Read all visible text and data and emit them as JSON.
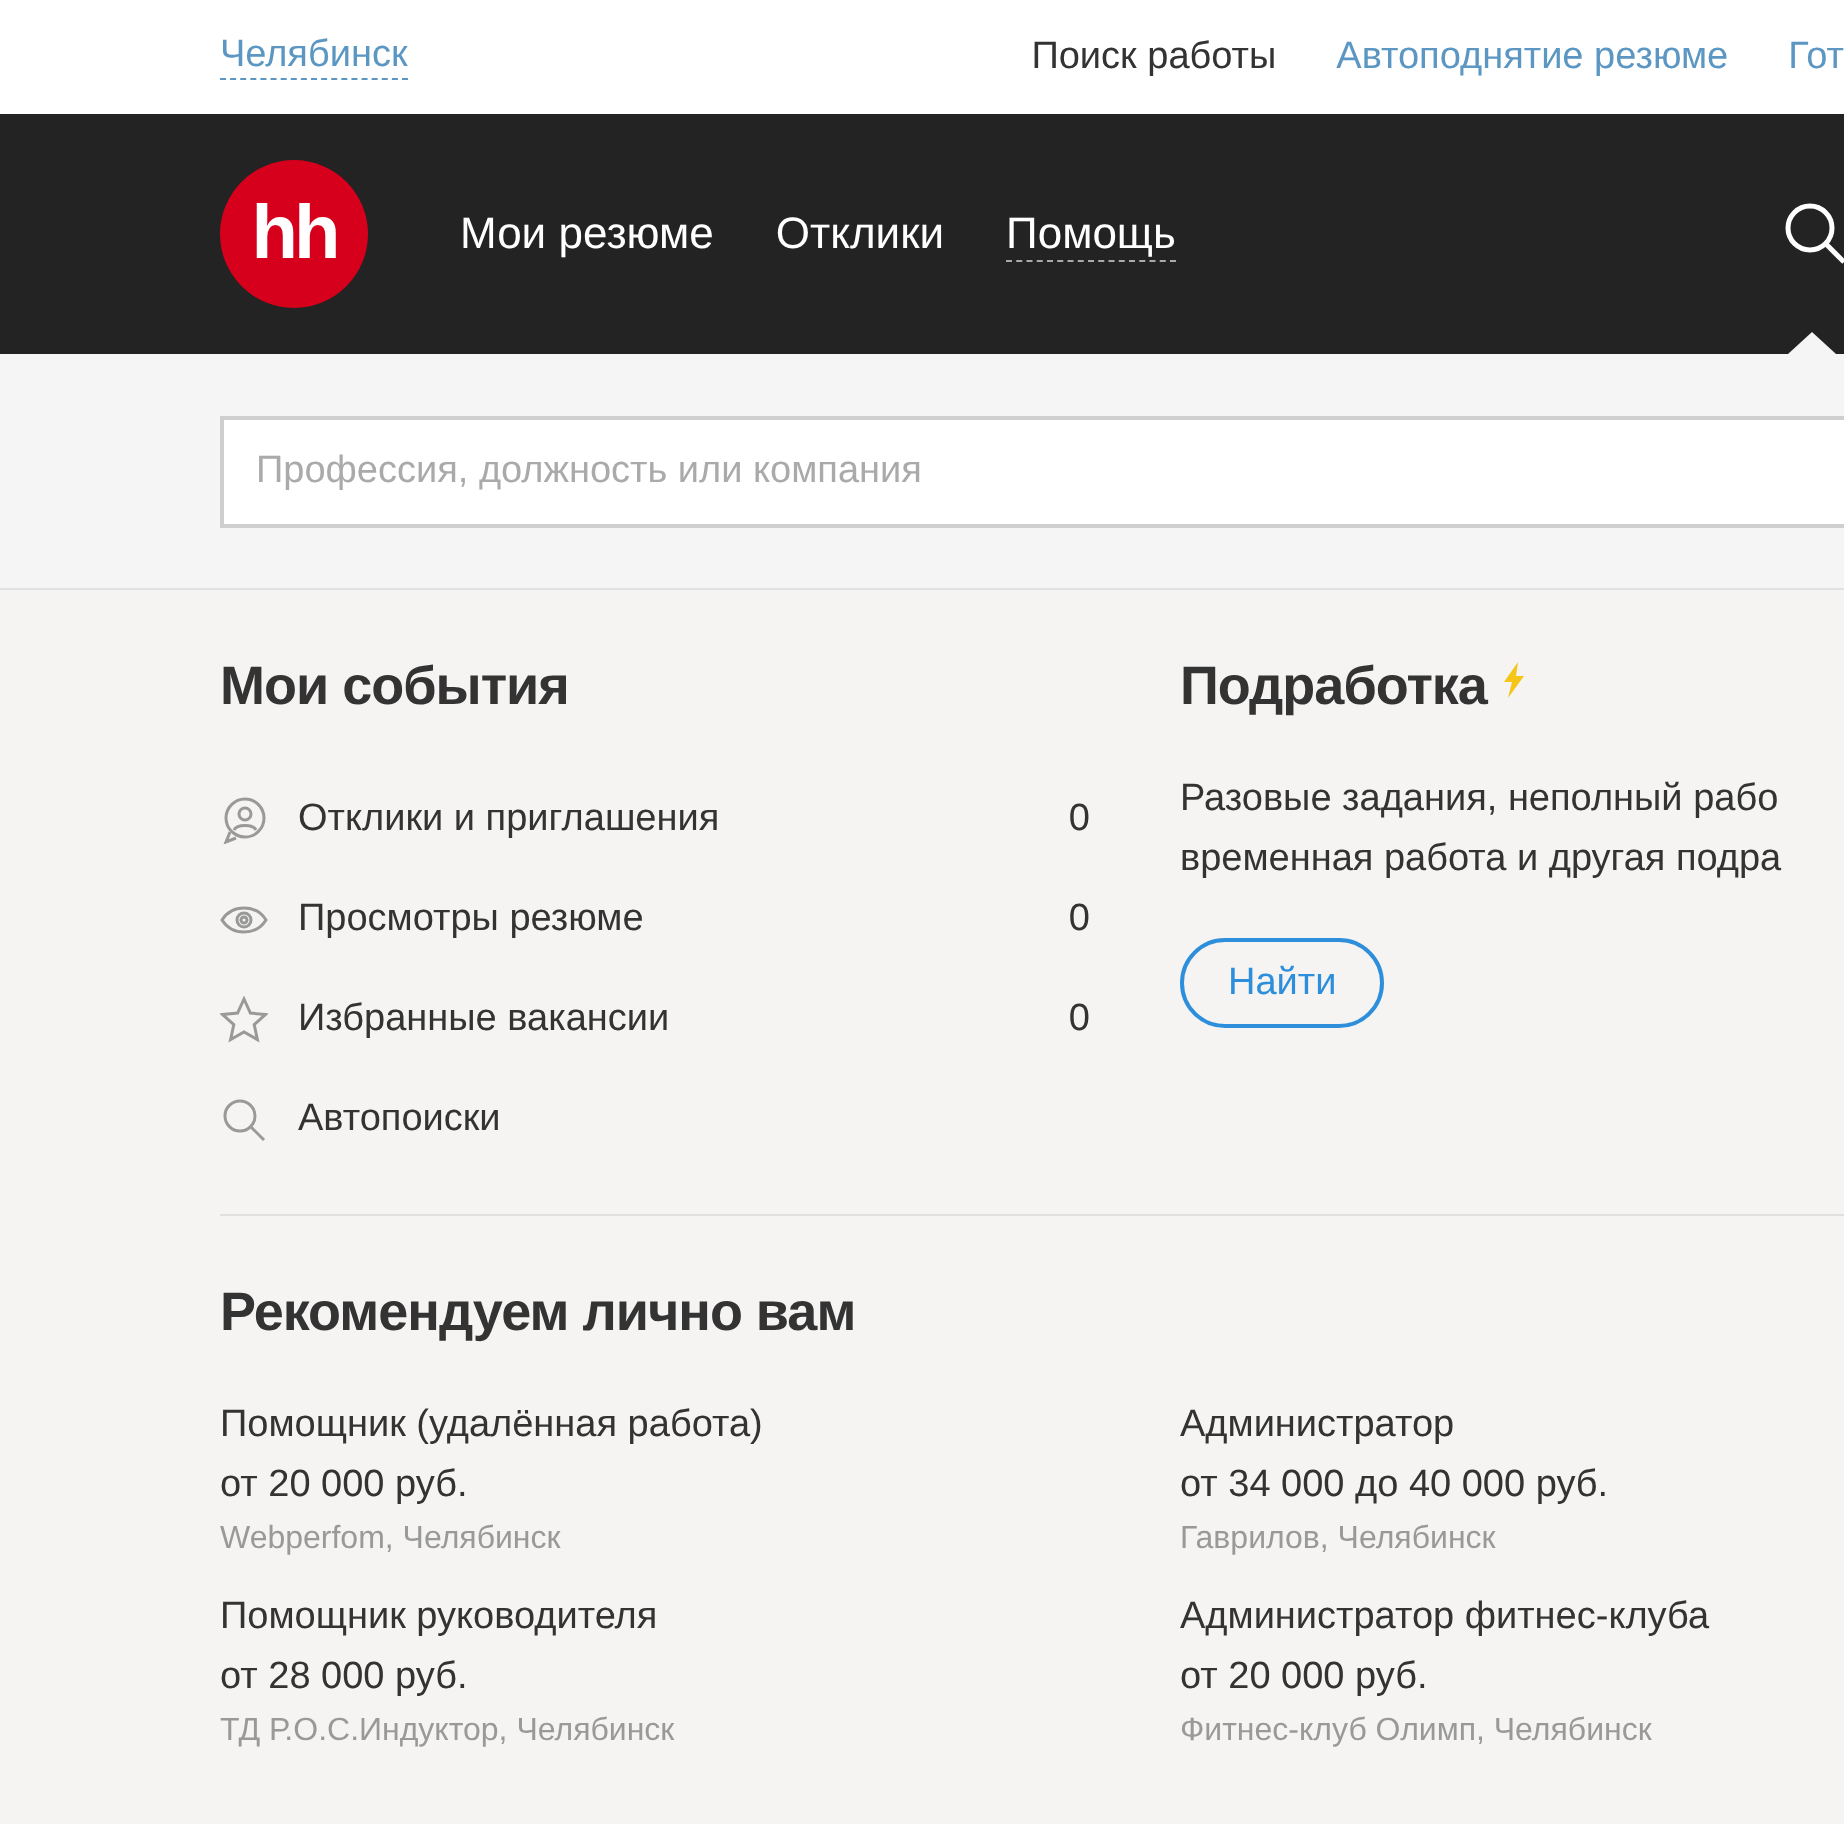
{
  "top_bar": {
    "city": "Челябинск",
    "links": [
      {
        "label": "Поиск работы",
        "selected": true
      },
      {
        "label": "Автоподнятие резюме",
        "selected": false
      },
      {
        "label": "Гот",
        "selected": false
      }
    ]
  },
  "header": {
    "logo": "hh",
    "nav": [
      {
        "label": "Мои резюме",
        "kind": "link"
      },
      {
        "label": "Отклики",
        "kind": "link"
      },
      {
        "label": "Помощь",
        "kind": "dropdown"
      }
    ]
  },
  "search": {
    "placeholder": "Профессия, должность или компания"
  },
  "events": {
    "title": "Мои события",
    "items": [
      {
        "kind": "responses",
        "label": "Отклики и приглашения",
        "count": "0"
      },
      {
        "kind": "views",
        "label": "Просмотры резюме",
        "count": "0"
      },
      {
        "kind": "favorites",
        "label": "Избранные вакансии",
        "count": "0"
      },
      {
        "kind": "autosearch",
        "label": "Автопоиски"
      }
    ]
  },
  "side_job": {
    "title": "Подработка",
    "lines": [
      "Разовые задания, неполный рабо",
      "временная работа и другая подра"
    ],
    "button": "Найти"
  },
  "recommended": {
    "title": "Рекомендуем лично вам",
    "vacancies": [
      {
        "title": "Помощник (удалённая работа)",
        "salary": "от 20 000 руб.",
        "company": "Webperfom, Челябинск"
      },
      {
        "title": "Администратор",
        "salary": "от 34 000 до 40 000 руб.",
        "company": "Гаврилов, Челябинск"
      },
      {
        "title": "Помощник руководителя",
        "salary": "от 28 000 руб.",
        "company": "ТД Р.О.С.Индуктор, Челябинск"
      },
      {
        "title": "Администратор фитнес-клуба",
        "salary": "от 20 000 руб.",
        "company": "Фитнес-клуб Олимп, Челябинск"
      }
    ]
  }
}
